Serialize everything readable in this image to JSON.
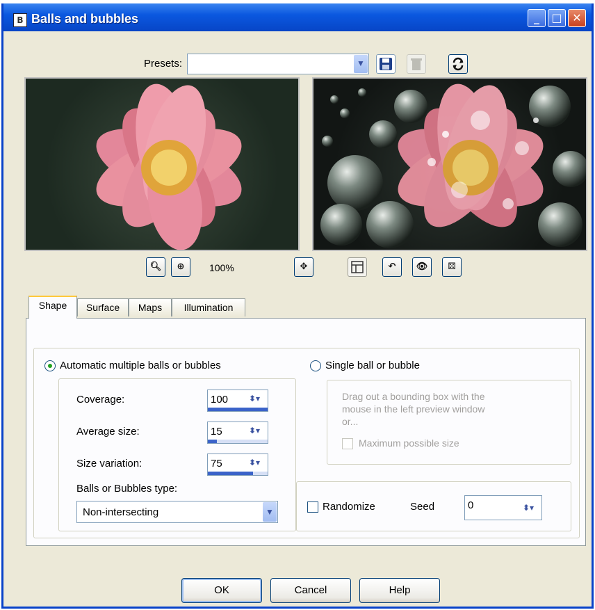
{
  "window": {
    "title": "Balls and bubbles",
    "icon_letter": "B"
  },
  "presets": {
    "label": "Presets:",
    "value": ""
  },
  "zoom": {
    "level": "100%"
  },
  "tabs": [
    "Shape",
    "Surface",
    "Maps",
    "Illumination"
  ],
  "active_tab": "Shape",
  "shape": {
    "auto_label": "Automatic multiple balls or bubbles",
    "single_label": "Single ball or bubble",
    "single_hint": [
      "Drag out a bounding box with the",
      "mouse in the left preview window",
      "or..."
    ],
    "max_size_label": "Maximum possible size",
    "coverage": {
      "label": "Coverage:",
      "value": "100",
      "fraction": 1.0
    },
    "average_size": {
      "label": "Average size:",
      "value": "15",
      "fraction": 0.15
    },
    "size_variation": {
      "label": "Size variation:",
      "value": "75",
      "fraction": 0.75
    },
    "type_label": "Balls or Bubbles type:",
    "type_value": "Non-intersecting",
    "randomize_label": "Randomize",
    "seed_label": "Seed",
    "seed_value": "0"
  },
  "buttons": {
    "ok": "OK",
    "cancel": "Cancel",
    "help": "Help"
  },
  "colors": {
    "title_bar": "#0b58e0",
    "dialog_bg": "#ece9d8",
    "accent": "#3b63c9",
    "flower_pink": "#e68a9b"
  },
  "icons": [
    "zoom-out-icon",
    "zoom-in-icon",
    "pan-icon",
    "preview-layout-icon",
    "undo-icon",
    "eye-icon",
    "dice-icon",
    "save-icon",
    "delete-icon",
    "reset-icon"
  ]
}
